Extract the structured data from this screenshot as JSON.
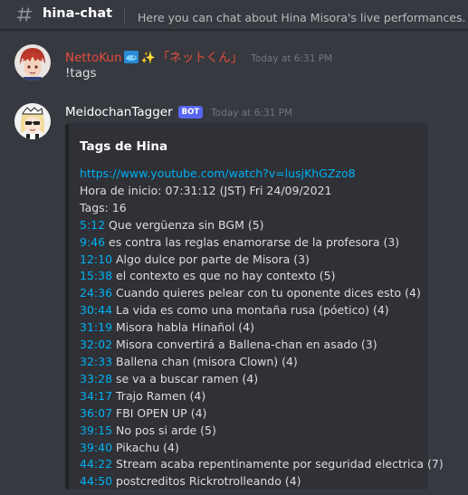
{
  "header": {
    "channel_name": "hina-chat",
    "topic": "Here you can chat about Hina Misora's live performances. 【Y"
  },
  "messages": [
    {
      "author": "NettoKun",
      "author_suffix": "「ネットくん」",
      "author_color": "#e74c3c",
      "timestamp": "Today at 6:31 PM",
      "text": "!tags"
    },
    {
      "author": "MeidochanTagger",
      "author_color": "#ffffff",
      "bot_tag": "BOT",
      "timestamp": "Today at 6:31 PM"
    }
  ],
  "embed": {
    "title": "Tags de Hina",
    "url": "https://www.youtube.com/watch?v=lusjKhGZzo8",
    "start": "Hora de inicio: 07:31:12 (JST) Fri 24/09/2021",
    "tag_count": "Tags: 16",
    "tags": [
      {
        "time": "5:12",
        "text": " Que vergüenza sin BGM (5)"
      },
      {
        "time": "9:46",
        "text": " es contra las reglas enamorarse de la profesora (3)"
      },
      {
        "time": "12:10",
        "text": " Algo dulce por parte de Misora (3)"
      },
      {
        "time": "15:38",
        "text": " el contexto es que no hay contexto (5)"
      },
      {
        "time": "24:36",
        "text": " Cuando quieres pelear con tu oponente dices esto (4)"
      },
      {
        "time": "30:44",
        "text": " La vida es como una montaña rusa (póetico) (4)"
      },
      {
        "time": "31:19",
        "text": " Misora habla Hinañol (4)"
      },
      {
        "time": "32:02",
        "text": " Misora convertirá a Ballena-chan en asado (3)"
      },
      {
        "time": "32:33",
        "text": " Ballena chan (misora Clown) (4)"
      },
      {
        "time": "33:28",
        "text": " se va a buscar ramen (4)"
      },
      {
        "time": "34:17",
        "text": " Trajo Ramen (4)"
      },
      {
        "time": "36:07",
        "text": " FBI OPEN UP (4)"
      },
      {
        "time": "39:15",
        "text": " No pos si arde (5)"
      },
      {
        "time": "39:40",
        "text": " Pikachu (4)"
      },
      {
        "time": "44:22",
        "text": " Stream acaba repentinamente por seguridad electrica (7)"
      },
      {
        "time": "44:50",
        "text": " postcreditos Rickrotrolleando (4)"
      }
    ]
  }
}
